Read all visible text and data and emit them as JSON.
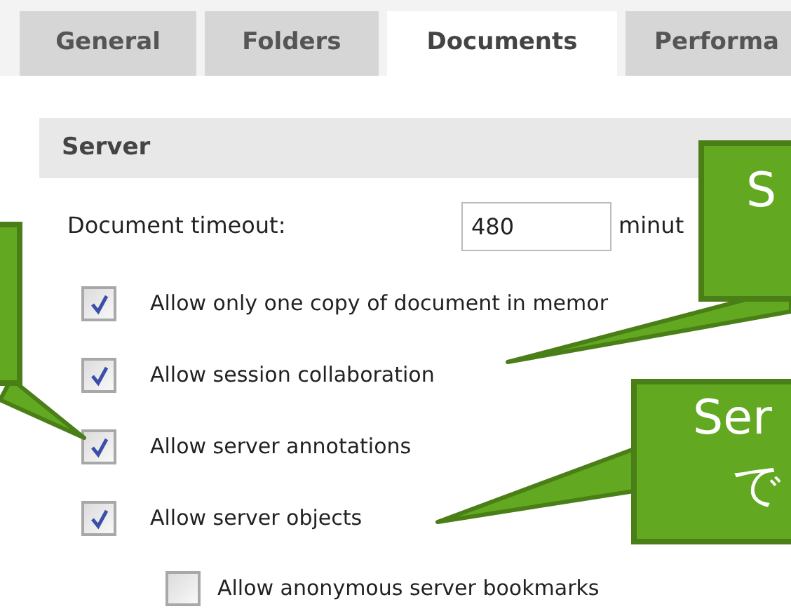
{
  "tabs": [
    {
      "label": "General",
      "selected": false
    },
    {
      "label": "Folders",
      "selected": false
    },
    {
      "label": "Documents",
      "selected": true
    },
    {
      "label": "Performa",
      "selected": false
    }
  ],
  "section": {
    "title": "Server"
  },
  "timeout": {
    "label": "Document timeout:",
    "value": "480",
    "unit": "minut"
  },
  "options": [
    {
      "label": "Allow only one copy of document in memor",
      "checked": true,
      "nested": false
    },
    {
      "label": "Allow session collaboration",
      "checked": true,
      "nested": false
    },
    {
      "label": "Allow server annotations",
      "checked": true,
      "nested": false
    },
    {
      "label": "Allow server objects",
      "checked": true,
      "nested": false
    },
    {
      "label": "Allow anonymous server bookmarks",
      "checked": false,
      "nested": true
    }
  ],
  "callouts": [
    {
      "kind": "left"
    },
    {
      "kind": "upper",
      "lines": [
        "S"
      ]
    },
    {
      "kind": "lower",
      "lines": [
        "Ser",
        "で"
      ]
    }
  ]
}
